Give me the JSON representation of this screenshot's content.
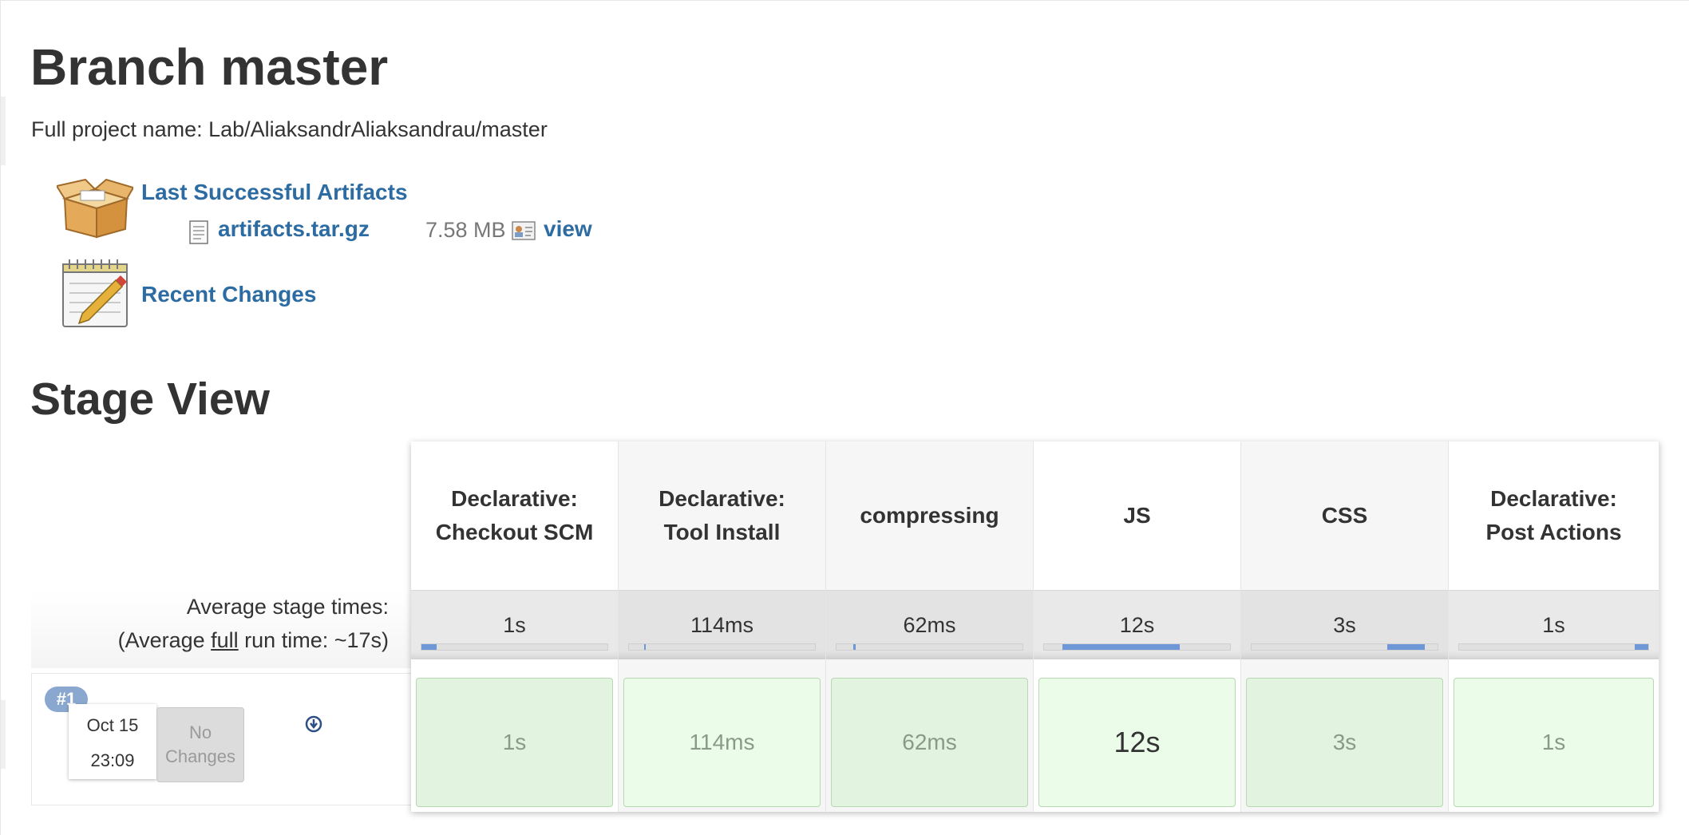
{
  "header": {
    "title": "Branch master",
    "full_project_name": "Full project name: Lab/AliaksandrAliaksandrau/master"
  },
  "artifacts": {
    "section_label": "Last Successful Artifacts",
    "icon": "box-icon",
    "file": {
      "name": "artifacts.tar.gz",
      "size": "7.58 MB",
      "view_label": "view"
    }
  },
  "recent_changes": {
    "label": "Recent Changes",
    "icon": "notepad-icon"
  },
  "stage_view": {
    "title": "Stage View",
    "avg_label_line1": "Average stage times:",
    "avg_label_line2_prefix": "(Average ",
    "avg_label_line2_underlined": "full",
    "avg_label_line2_suffix": " run time: ~17s)",
    "stages": [
      {
        "name": "Declarative: Checkout SCM",
        "avg": "1s",
        "run": "1s",
        "bar_start": 0.0,
        "bar_end": 0.08
      },
      {
        "name": "Declarative: Tool Install",
        "avg": "114ms",
        "run": "114ms",
        "bar_start": 0.08,
        "bar_end": 0.09
      },
      {
        "name": "compressing",
        "avg": "62ms",
        "run": "62ms",
        "bar_start": 0.09,
        "bar_end": 0.1
      },
      {
        "name": "JS",
        "avg": "12s",
        "run": "12s",
        "bar_start": 0.1,
        "bar_end": 0.73
      },
      {
        "name": "CSS",
        "avg": "3s",
        "run": "3s",
        "bar_start": 0.73,
        "bar_end": 0.93
      },
      {
        "name": "Declarative: Post Actions",
        "avg": "1s",
        "run": "1s",
        "bar_start": 0.93,
        "bar_end": 1.0
      }
    ],
    "run": {
      "number": "#1",
      "date": "Oct 15",
      "time": "23:09",
      "changes_line1": "No",
      "changes_line2": "Changes"
    }
  },
  "colors": {
    "link": "#2d6ca2",
    "bar_fill": "#6d97d6",
    "success_cell": "#e2f3df",
    "badge": "#8aa8cf"
  }
}
